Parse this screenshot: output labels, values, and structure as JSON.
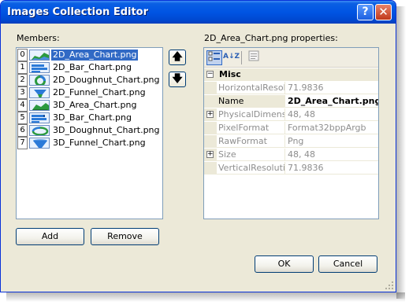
{
  "window": {
    "title": "Images Collection Editor",
    "help_glyph": "?",
    "close_glyph": "✕"
  },
  "members": {
    "label": "Members:",
    "selected_index": 0,
    "items": [
      {
        "index": "0",
        "name": "2D_Area_Chart.png"
      },
      {
        "index": "1",
        "name": "2D_Bar_Chart.png"
      },
      {
        "index": "2",
        "name": "2D_Doughnut_Chart.png"
      },
      {
        "index": "3",
        "name": "2D_Funnel_Chart.png"
      },
      {
        "index": "4",
        "name": "3D_Area_Chart.png"
      },
      {
        "index": "5",
        "name": "3D_Bar_Chart.png"
      },
      {
        "index": "6",
        "name": "3D_Doughnut_Chart.png"
      },
      {
        "index": "7",
        "name": "3D_Funnel_Chart.png"
      }
    ],
    "move_up_glyph": "🡅",
    "move_down_glyph": "🡇"
  },
  "buttons": {
    "add": "Add",
    "remove": "Remove",
    "ok": "OK",
    "cancel": "Cancel"
  },
  "properties": {
    "label": "2D_Area_Chart.png properties:",
    "category": {
      "expander": "−",
      "name": "Misc"
    },
    "rows": [
      {
        "name": "HorizontalResolut",
        "value": "71.9836",
        "expandable": false
      },
      {
        "name": "Name",
        "value": "2D_Area_Chart.png",
        "expandable": false
      },
      {
        "name": "PhysicalDimension",
        "value": "48, 48",
        "expandable": true
      },
      {
        "name": "PixelFormat",
        "value": "Format32bppArgb",
        "expandable": false
      },
      {
        "name": "RawFormat",
        "value": "Png",
        "expandable": false
      },
      {
        "name": "Size",
        "value": "48, 48",
        "expandable": true
      },
      {
        "name": "VerticalResolution",
        "value": "71.9836",
        "expandable": false
      }
    ],
    "expand_glyph": "+",
    "toolbar": {
      "sort_az_glyph": "A↓Z"
    }
  },
  "colors": {
    "titlebar": "#0054e3",
    "selection": "#316ac5",
    "dialog_bg": "#ece9d8",
    "close_red": "#c0381b"
  }
}
